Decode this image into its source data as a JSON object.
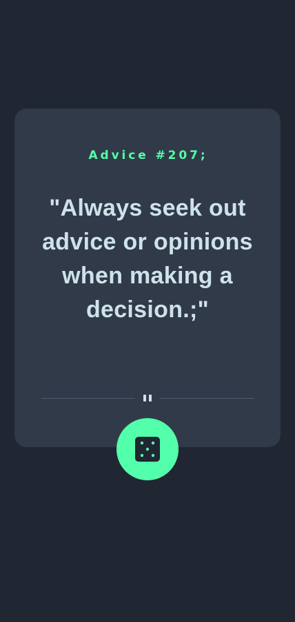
{
  "advice": {
    "id_label": "Advice #207;",
    "quote": "\"Always seek out advice or opinions when making a decision.;\""
  },
  "icons": {
    "divider": "pause-icon",
    "button": "dice-icon"
  },
  "colors": {
    "background": "#202632",
    "card": "#313a48",
    "accent": "#53ffaa",
    "text": "#cee3e9",
    "divider": "#4f5d74"
  }
}
